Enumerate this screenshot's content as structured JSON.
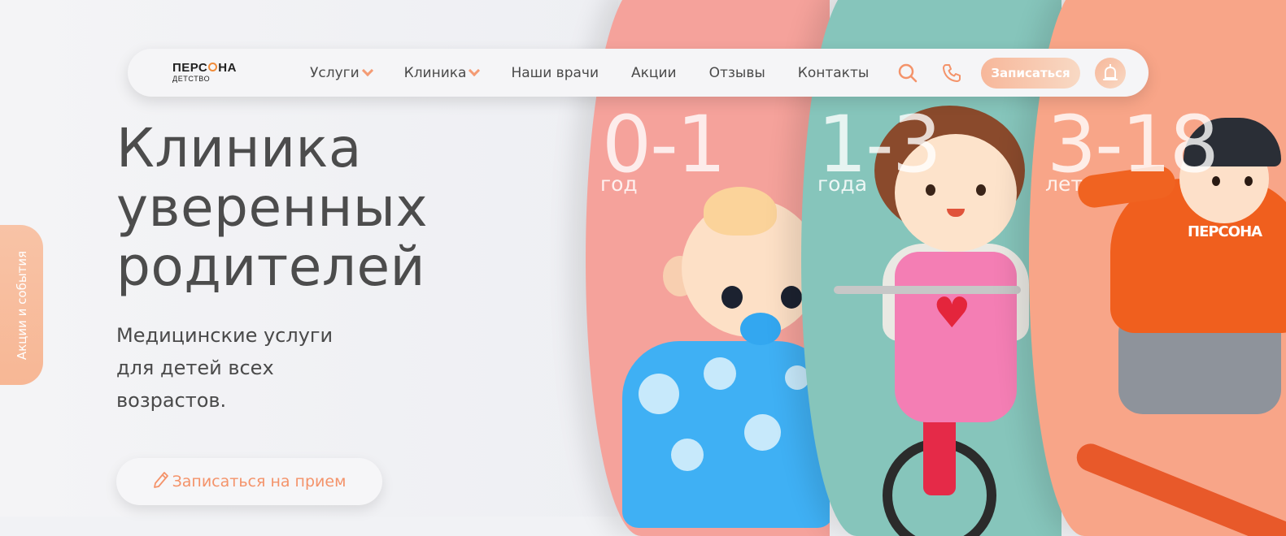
{
  "brand": {
    "name_part1": "ПЕРС",
    "name_part2": "НА",
    "sub": "ДЕТСТВО"
  },
  "nav": {
    "items": [
      {
        "label": "Услуги",
        "has_dropdown": true
      },
      {
        "label": "Клиника",
        "has_dropdown": true
      },
      {
        "label": "Наши врачи",
        "has_dropdown": false
      },
      {
        "label": "Акции",
        "has_dropdown": false
      },
      {
        "label": "Отзывы",
        "has_dropdown": false
      },
      {
        "label": "Контакты",
        "has_dropdown": false
      }
    ],
    "search_icon": "search-icon",
    "phone_icon": "phone-icon",
    "cta_label": "Записаться",
    "alert_icon": "siren-icon"
  },
  "hero": {
    "title": "Клиника\nуверенных\nродителей",
    "subtitle": "Медицинские услуги\nдля детей всех\nвозрастов.",
    "appointment_label": "Записаться на прием",
    "appointment_icon": "pencil-icon"
  },
  "side_tab": {
    "label": "Акции и события"
  },
  "age_groups": [
    {
      "range": "0-1",
      "unit": "год",
      "color": "#f5a29b"
    },
    {
      "range": "1-3",
      "unit": "года",
      "color": "#86c5bb"
    },
    {
      "range": "3-18",
      "unit": "лет",
      "color": "#f8a588"
    }
  ],
  "colors": {
    "accent": "#f4936a",
    "text": "#4a4a4a",
    "background": "#f1f2f5"
  }
}
